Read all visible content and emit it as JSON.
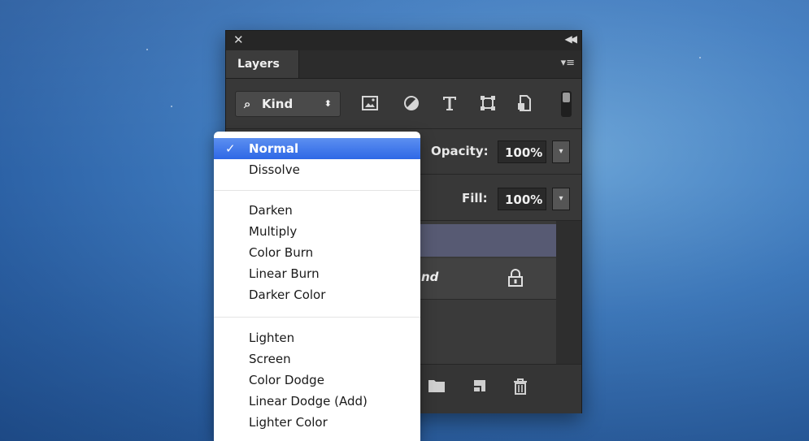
{
  "panel": {
    "close_glyph": "✕",
    "collapse_glyph": "◀◀",
    "tab_label": "Layers",
    "menu_glyph": "▾≡",
    "filter": {
      "kind_label": "Kind",
      "search_glyph": "⌕",
      "spinner_glyph": "⬍",
      "icons": [
        "image-filter-icon",
        "adjustment-filter-icon",
        "type-filter-icon",
        "shape-filter-icon",
        "smart-object-filter-icon"
      ]
    },
    "opacity": {
      "label": "Opacity:",
      "value": "100%"
    },
    "fill": {
      "label": "Fill:",
      "value": "100%"
    },
    "stepper_glyph": "▾",
    "layers": [
      {
        "name": "nd",
        "locked": true
      }
    ],
    "footer_icons": [
      "folder-icon",
      "new-layer-icon",
      "trash-icon"
    ]
  },
  "blend_menu": {
    "selected": "Normal",
    "check_glyph": "✓",
    "groups": [
      [
        "Normal",
        "Dissolve"
      ],
      [
        "Darken",
        "Multiply",
        "Color Burn",
        "Linear Burn",
        "Darker Color"
      ],
      [
        "Lighten",
        "Screen",
        "Color Dodge",
        "Linear Dodge (Add)",
        "Lighter Color"
      ]
    ],
    "items": {
      "normal": "Normal",
      "dissolve": "Dissolve",
      "darken": "Darken",
      "multiply": "Multiply",
      "color_burn": "Color Burn",
      "linear_burn": "Linear Burn",
      "darker_color": "Darker Color",
      "lighten": "Lighten",
      "screen": "Screen",
      "color_dodge": "Color Dodge",
      "linear_dodge": "Linear Dodge (Add)",
      "lighter_color": "Lighter Color"
    }
  },
  "colors": {
    "panel_bg": "#383838",
    "selection_blue": "#2e68e6",
    "selected_layer": "#575a73"
  }
}
